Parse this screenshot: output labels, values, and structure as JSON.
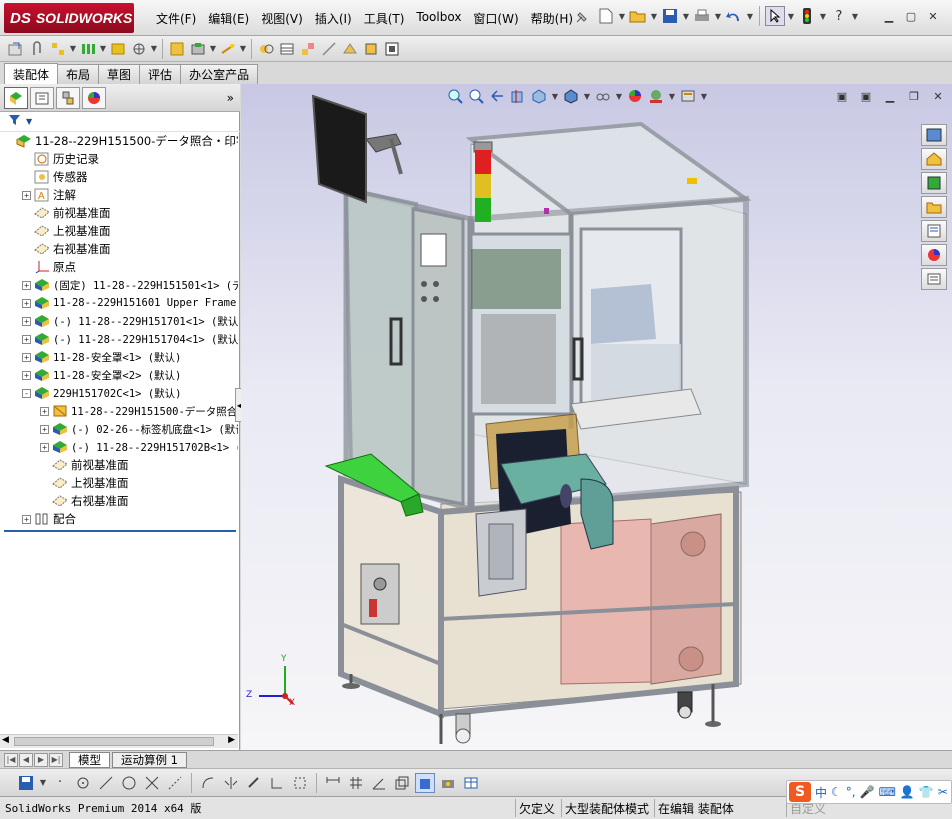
{
  "app": {
    "logo_text": "SOLIDWORKS",
    "logo_ds": "DS"
  },
  "menu": [
    "文件(F)",
    "编辑(E)",
    "视图(V)",
    "插入(I)",
    "工具(T)",
    "Toolbox",
    "窗口(W)",
    "帮助(H)"
  ],
  "tabs": [
    {
      "label": "装配体",
      "active": true
    },
    {
      "label": "布局",
      "active": false
    },
    {
      "label": "草图",
      "active": false
    },
    {
      "label": "评估",
      "active": false
    },
    {
      "label": "办公室产品",
      "active": false
    }
  ],
  "feature_tree": [
    {
      "label": "11-28--229H151500-データ照合・印字装",
      "icon": "assembly-icon",
      "exp": "",
      "indent": 0,
      "mono": false
    },
    {
      "label": "历史记录",
      "icon": "history-icon",
      "exp": "",
      "indent": 1,
      "mono": false
    },
    {
      "label": "传感器",
      "icon": "sensor-icon",
      "exp": "",
      "indent": 1,
      "mono": false
    },
    {
      "label": "注解",
      "icon": "annotation-icon",
      "exp": "+",
      "indent": 1,
      "mono": false
    },
    {
      "label": "前视基准面",
      "icon": "plane-icon",
      "exp": "",
      "indent": 1,
      "mono": false
    },
    {
      "label": "上视基准面",
      "icon": "plane-icon",
      "exp": "",
      "indent": 1,
      "mono": false
    },
    {
      "label": "右视基准面",
      "icon": "plane-icon",
      "exp": "",
      "indent": 1,
      "mono": false
    },
    {
      "label": "原点",
      "icon": "origin-icon",
      "exp": "",
      "indent": 1,
      "mono": false
    },
    {
      "label": "(固定) 11-28--229H151501<1> (デフ",
      "icon": "subassembly-icon",
      "exp": "+",
      "indent": 1,
      "mono": true
    },
    {
      "label": "11-28--229H151601 Upper Frame As",
      "icon": "subassembly-icon",
      "exp": "+",
      "indent": 1,
      "mono": true
    },
    {
      "label": "(-) 11-28--229H151701<1> (默认)",
      "icon": "subassembly-icon",
      "exp": "+",
      "indent": 1,
      "mono": true
    },
    {
      "label": "(-) 11-28--229H151704<1> (默认)",
      "icon": "subassembly-icon",
      "exp": "+",
      "indent": 1,
      "mono": true
    },
    {
      "label": "11-28-安全罩<1> (默认)",
      "icon": "subassembly-icon",
      "exp": "+",
      "indent": 1,
      "mono": true
    },
    {
      "label": "11-28-安全罩<2> (默认)",
      "icon": "subassembly-icon",
      "exp": "+",
      "indent": 1,
      "mono": true
    },
    {
      "label": "229H151702C<1> (默认)",
      "icon": "subassembly-icon",
      "exp": "-",
      "indent": 1,
      "mono": true
    },
    {
      "label": "11-28--229H151500-データ照合・",
      "icon": "part-icon",
      "exp": "+",
      "indent": 2,
      "mono": true
    },
    {
      "label": "(-) 02-26--标签机底盘<1> (默认",
      "icon": "subassembly-icon",
      "exp": "+",
      "indent": 2,
      "mono": true
    },
    {
      "label": "(-) 11-28--229H151702B<1> (默",
      "icon": "subassembly-icon",
      "exp": "+",
      "indent": 2,
      "mono": true
    },
    {
      "label": "前视基准面",
      "icon": "plane-icon",
      "exp": "",
      "indent": 2,
      "mono": false
    },
    {
      "label": "上视基准面",
      "icon": "plane-icon",
      "exp": "",
      "indent": 2,
      "mono": false
    },
    {
      "label": "右视基准面",
      "icon": "plane-icon",
      "exp": "",
      "indent": 2,
      "mono": false
    },
    {
      "label": "配合",
      "icon": "mates-icon",
      "exp": "+",
      "indent": 1,
      "mono": false
    }
  ],
  "bottom_tabs": [
    {
      "label": "模型",
      "active": true
    },
    {
      "label": "运动算例 1",
      "active": false
    }
  ],
  "status": {
    "product": "SolidWorks Premium 2014 x64 版",
    "under_defined": "欠定义",
    "large_assembly": "大型装配体模式",
    "editing": "在编辑 装配体",
    "custom": "自定义"
  },
  "ime": {
    "logo": "S",
    "mode": "中"
  },
  "axes": {
    "x": "X",
    "y": "Y",
    "z": "Z"
  },
  "colors": {
    "logo_red": "#c8102e",
    "viewport_top": "#c8c8e4",
    "frame": "#9aa0a8",
    "green_tray": "#3fd23f",
    "stack_red": "#e02020",
    "stack_yellow": "#e0c020",
    "stack_green": "#20b020"
  }
}
